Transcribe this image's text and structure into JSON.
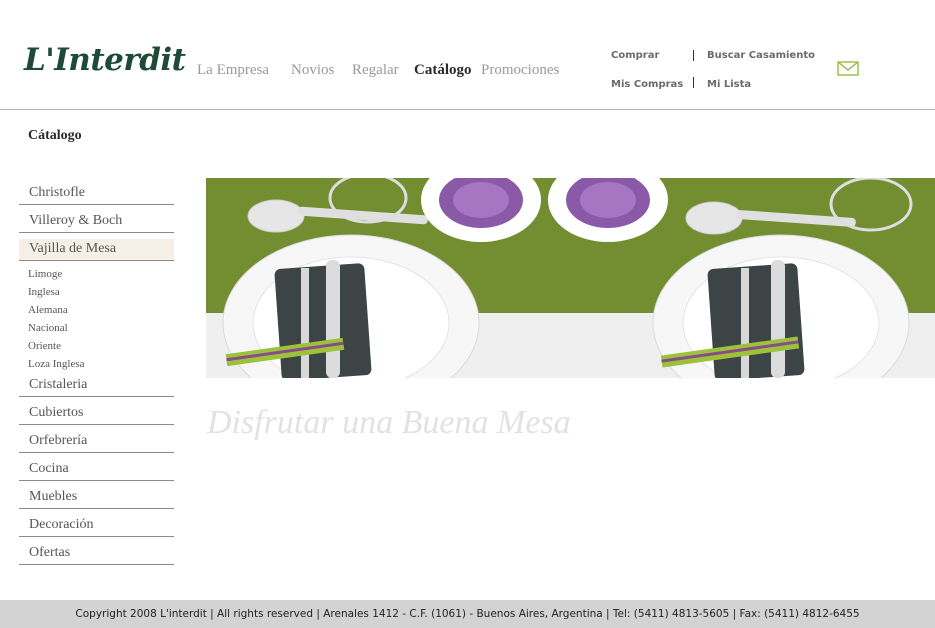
{
  "brand": {
    "logo_text": "L'Interdit"
  },
  "nav": {
    "items": [
      {
        "label": "La Empresa"
      },
      {
        "label": "Novios"
      },
      {
        "label": "Regalar"
      },
      {
        "label": "Catálogo"
      },
      {
        "label": "Promociones"
      }
    ]
  },
  "utility": {
    "comprar": "Comprar",
    "buscar": "Buscar Casamiento",
    "mis_compras": "Mis Compras",
    "mi_lista": "Mi Lista"
  },
  "icons": {
    "mail": "mail-icon"
  },
  "colors": {
    "brand_green": "#1f4a3a",
    "mail_icon": "#9fbf4a",
    "banner_green": "#6f8b2e",
    "footer_bg": "#d3d3d3"
  },
  "sidebar": {
    "title": "Cátalogo",
    "items": [
      {
        "label": "Christofle"
      },
      {
        "label": "Villeroy & Boch"
      },
      {
        "label": "Vajilla de Mesa"
      },
      {
        "label": "Cristaleria"
      },
      {
        "label": "Cubiertos"
      },
      {
        "label": "Orfebrería"
      },
      {
        "label": "Cocina"
      },
      {
        "label": "Muebles"
      },
      {
        "label": "Decoración"
      },
      {
        "label": "Ofertas"
      }
    ],
    "subitems": [
      {
        "label": "Limoge"
      },
      {
        "label": "Inglesa"
      },
      {
        "label": "Alemana"
      },
      {
        "label": "Nacional"
      },
      {
        "label": "Oriente"
      },
      {
        "label": "Loza Inglesa"
      }
    ]
  },
  "main": {
    "tagline": "Disfrutar una Buena Mesa"
  },
  "footer": {
    "text": "Copyright 2008 L'interdit | All rights reserved | Arenales 1412 - C.F. (1061) - Buenos Aires, Argentina | Tel: (5411) 4813-5605 | Fax: (5411) 4812-6455"
  }
}
